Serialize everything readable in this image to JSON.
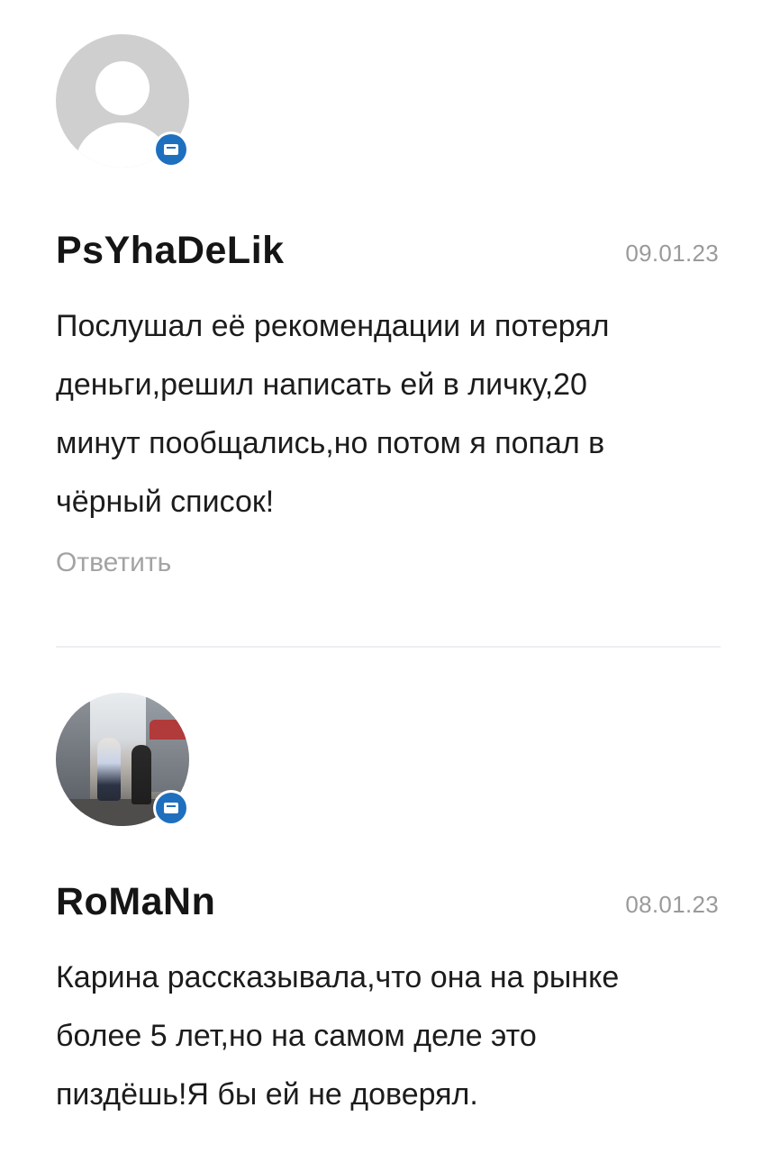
{
  "comments": [
    {
      "username": "PsYhaDeLik",
      "date": "09.01.23",
      "text": "Послушал её рекомендации и потерял\nденьги,решил написать ей в личку,20\nминут пообщались,но потом я попал в\nчёрный список!",
      "reply_label": "Ответить",
      "avatar": "default-user-icon",
      "badge_icon": "mail-icon"
    },
    {
      "username": "RoMaNn",
      "date": "08.01.23",
      "text": "Карина рассказывала,что она на рынке\nболее 5 лет,но на самом деле это\nпиздёшь!Я бы ей не доверял.",
      "avatar": "user-photo",
      "badge_icon": "mail-icon"
    }
  ],
  "colors": {
    "badge": "#1f6fbf",
    "date": "#9a9a9a",
    "reply": "#a3a3a3",
    "divider": "#eceef2"
  }
}
